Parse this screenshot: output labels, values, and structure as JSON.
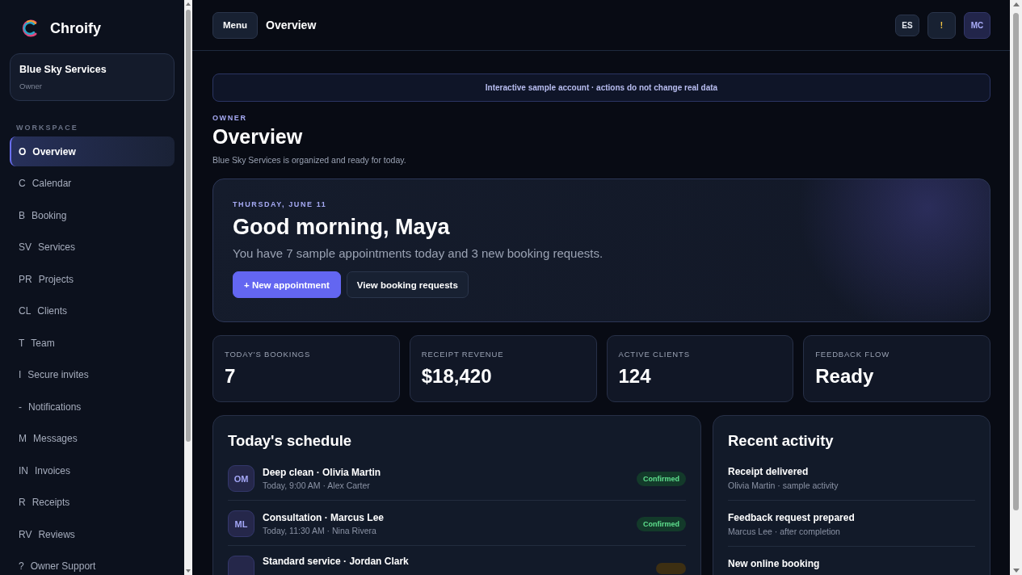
{
  "brand": {
    "name": "Chroify"
  },
  "account": {
    "name": "Blue Sky Services",
    "role": "Owner"
  },
  "sidebar": {
    "section": "WORKSPACE",
    "items": [
      {
        "code": "O",
        "label": "Overview",
        "selected": true
      },
      {
        "code": "C",
        "label": "Calendar",
        "selected": false
      },
      {
        "code": "B",
        "label": "Booking",
        "selected": false
      },
      {
        "code": "SV",
        "label": "Services",
        "selected": false
      },
      {
        "code": "PR",
        "label": "Projects",
        "selected": false
      },
      {
        "code": "CL",
        "label": "Clients",
        "selected": false
      },
      {
        "code": "T",
        "label": "Team",
        "selected": false
      },
      {
        "code": "I",
        "label": "Secure invites",
        "selected": false
      },
      {
        "code": "-",
        "label": "Notifications",
        "selected": false
      },
      {
        "code": "M",
        "label": "Messages",
        "selected": false
      },
      {
        "code": "IN",
        "label": "Invoices",
        "selected": false
      },
      {
        "code": "R",
        "label": "Receipts",
        "selected": false
      },
      {
        "code": "RV",
        "label": "Reviews",
        "selected": false
      },
      {
        "code": "?",
        "label": "Owner Support",
        "selected": false
      }
    ]
  },
  "topbar": {
    "menu": "Menu",
    "title": "Overview",
    "language": "ES",
    "alert": "!",
    "user": "MC"
  },
  "notice": "Interactive sample account · actions do not change real data",
  "page": {
    "eyebrow": "OWNER",
    "title": "Overview",
    "subtitle": "Blue Sky Services is organized and ready for today."
  },
  "hero": {
    "date": "THURSDAY, JUNE 11",
    "greeting": "Good morning, Maya",
    "summary": "You have 7 sample appointments today and 3 new booking requests.",
    "primary_action": "+ New appointment",
    "secondary_action": "View booking requests"
  },
  "stats": [
    {
      "label": "TODAY'S BOOKINGS",
      "value": "7"
    },
    {
      "label": "RECEIPT REVENUE",
      "value": "$18,420"
    },
    {
      "label": "ACTIVE CLIENTS",
      "value": "124"
    },
    {
      "label": "FEEDBACK FLOW",
      "value": "Ready"
    }
  ],
  "schedule": {
    "title": "Today's schedule",
    "rows": [
      {
        "initials": "OM",
        "title": "Deep clean · Olivia Martin",
        "detail": "Today, 9:00 AM · Alex Carter",
        "status": "Confirmed",
        "kind": "confirmed"
      },
      {
        "initials": "ML",
        "title": "Consultation · Marcus Lee",
        "detail": "Today, 11:30 AM · Nina Rivera",
        "status": "Confirmed",
        "kind": "confirmed"
      },
      {
        "title": "Standard service · Jordan Clark",
        "kind": "pending"
      }
    ]
  },
  "activity": {
    "title": "Recent activity",
    "items": [
      {
        "title": "Receipt delivered",
        "detail": "Olivia Martin · sample activity"
      },
      {
        "title": "Feedback request prepared",
        "detail": "Marcus Lee · after completion"
      },
      {
        "title": "New online booking"
      }
    ]
  }
}
